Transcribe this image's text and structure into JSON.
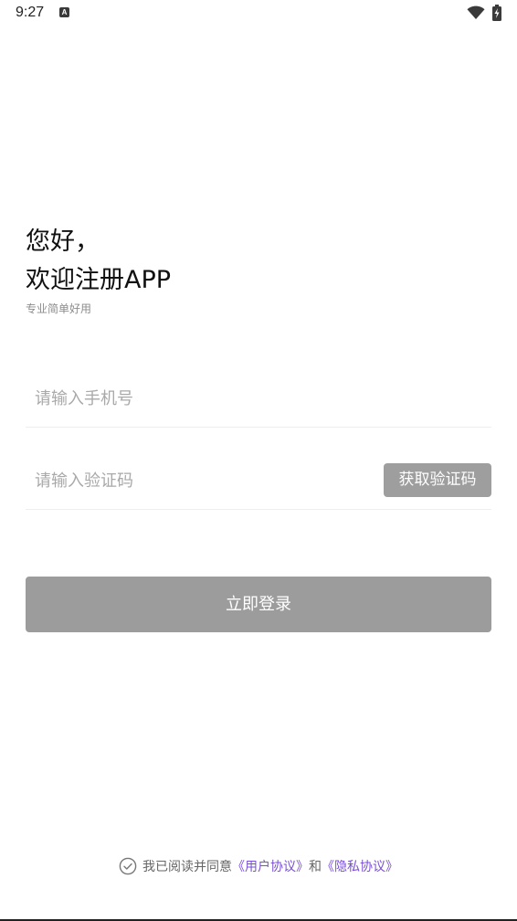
{
  "status_bar": {
    "time": "9:27",
    "notification_letter": "A",
    "icons": [
      "wifi-icon",
      "battery-charging-icon"
    ]
  },
  "header": {
    "greeting_line1": "您好，",
    "greeting_line2": "欢迎注册APP",
    "subtitle": "专业简单好用"
  },
  "form": {
    "phone_placeholder": "请输入手机号",
    "code_placeholder": "请输入验证码",
    "get_code_label": "获取验证码",
    "login_label": "立即登录"
  },
  "agreement": {
    "prefix": "我已阅读并同意",
    "user_agreement": "《用户协议》",
    "conjunction": "和",
    "privacy_policy": "《隐私协议》",
    "link_color": "#7b4fd9"
  },
  "colors": {
    "button_gray": "#9c9c9c",
    "placeholder": "#a9a9a9"
  }
}
